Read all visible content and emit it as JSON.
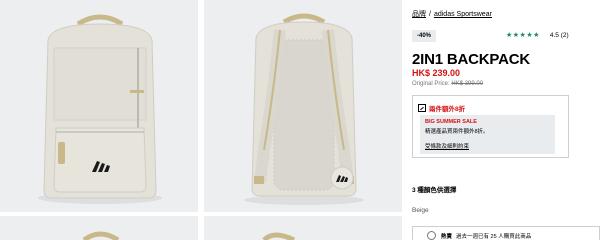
{
  "breadcrumb": {
    "brand_link": "品牌",
    "separator": "/",
    "current": "adidas Sportswear"
  },
  "gallery": {
    "images": [
      {
        "name": "backpack-front-image",
        "icon": "backpack-front"
      },
      {
        "name": "backpack-back-image",
        "icon": "backpack-back"
      },
      {
        "name": "backpack-thumbnail-3",
        "icon": "backpack-strap"
      },
      {
        "name": "backpack-thumbnail-4",
        "icon": "backpack-strap"
      }
    ],
    "colors": {
      "background": "#eceeef",
      "bag_body": "#e3e1d8",
      "bag_trim": "#c8b88a"
    }
  },
  "product": {
    "discount_badge": "-40%",
    "rating_stars": "★★★★★",
    "rating_value": "4.5",
    "review_count": "(2)",
    "title": "2IN1 BACKPACK",
    "price": "HK$ 239.00",
    "original_price_label": "Original Price:",
    "original_price": "HK$ 399.00"
  },
  "promo": {
    "icon": "tag-icon",
    "title": "兩件額外8折",
    "headline": "BIG SUMMER SALE",
    "description": "精選產品買兩件額外8折。",
    "terms_link": "受條款及細則約束"
  },
  "colors_section": {
    "label": "3 種顏色供選擇",
    "selected_color": "Beige"
  },
  "trending": {
    "icon": "flame-icon",
    "label": "熱賣",
    "text": "過去一週已有 25 人購買此商品"
  },
  "theme": {
    "sale_red": "#d41414",
    "rating_green": "#1f8a5b",
    "badge_gray": "#e9ecef"
  }
}
